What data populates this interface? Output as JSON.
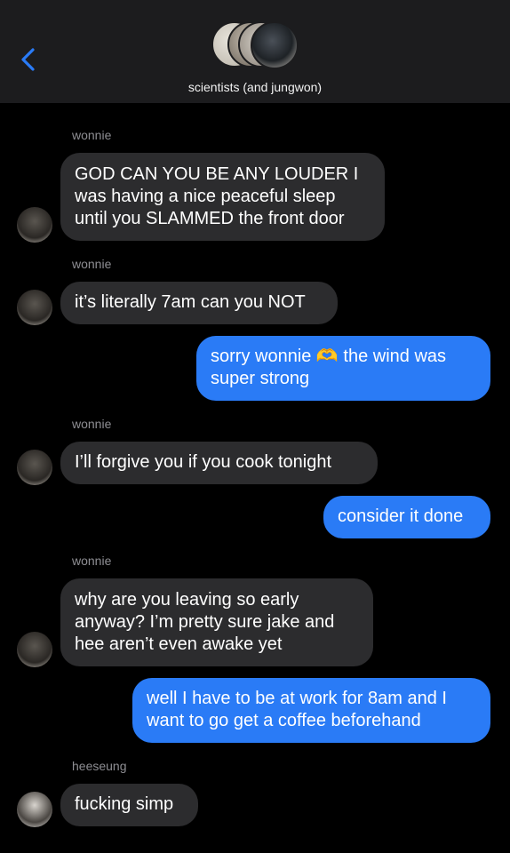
{
  "header": {
    "group_title": "scientists (and jungwon)",
    "back_icon": "chevron-left-icon",
    "accent": "#2a7bf6"
  },
  "messages": [
    {
      "sender": "wonnie",
      "direction": "in",
      "lines": [
        "GOD CAN YOU BE ANY LOUDER I",
        "was having a nice peaceful sleep",
        "until you SLAMMED the front door"
      ]
    },
    {
      "sender": "wonnie",
      "direction": "in",
      "lines": [
        "it’s literally 7am can you NOT"
      ]
    },
    {
      "direction": "out",
      "lines": [
        "sorry wonnie 🫶 the wind was",
        "super strong"
      ]
    },
    {
      "sender": "wonnie",
      "direction": "in",
      "lines": [
        "I’ll forgive you if you cook tonight"
      ]
    },
    {
      "direction": "out",
      "lines": [
        "consider it done"
      ]
    },
    {
      "sender": "wonnie",
      "direction": "in",
      "lines": [
        "why are you leaving so early",
        "anyway? I’m pretty sure jake and",
        "hee aren’t even awake yet"
      ]
    },
    {
      "direction": "out",
      "lines": [
        "well I have to be at work for 8am and I",
        "want to go get a coffee beforehand"
      ]
    },
    {
      "sender": "heeseung",
      "direction": "in",
      "lines": [
        "fucking simp"
      ]
    }
  ]
}
